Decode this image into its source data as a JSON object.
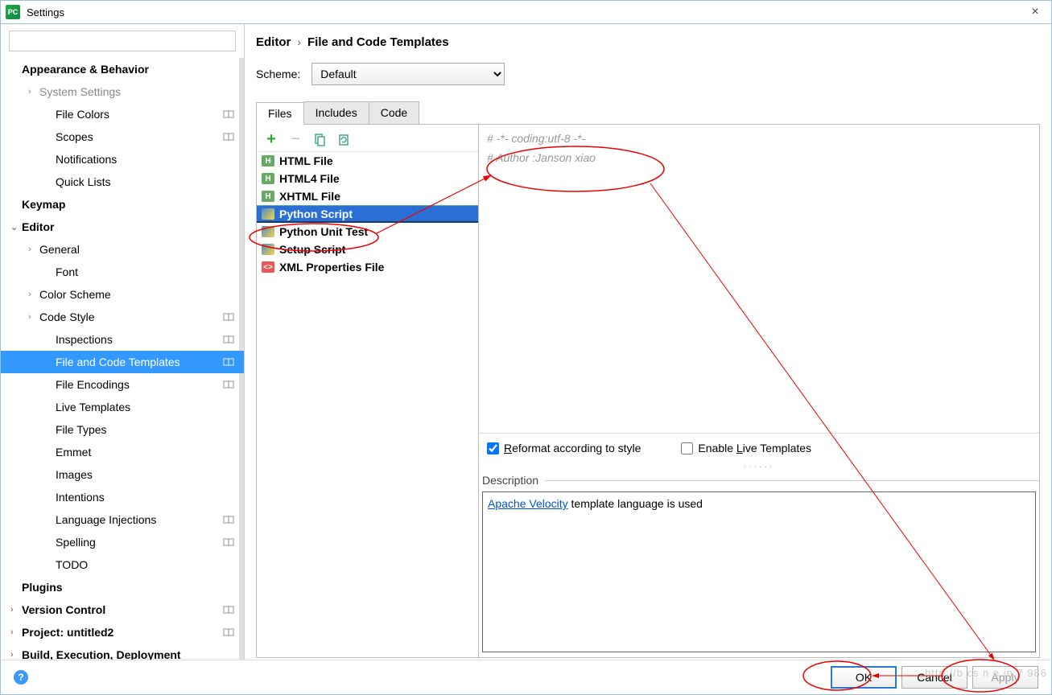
{
  "window": {
    "title": "Settings"
  },
  "search": {
    "placeholder": ""
  },
  "sidebar": {
    "items": [
      {
        "label": "Appearance & Behavior",
        "bold": true,
        "indent": 0,
        "chev": ""
      },
      {
        "label": "System Settings",
        "bold": false,
        "indent": 1,
        "dim": true,
        "chev": "›"
      },
      {
        "label": "File Colors",
        "indent": 2,
        "badge": true
      },
      {
        "label": "Scopes",
        "indent": 2,
        "badge": true
      },
      {
        "label": "Notifications",
        "indent": 2
      },
      {
        "label": "Quick Lists",
        "indent": 2
      },
      {
        "label": "Keymap",
        "bold": true,
        "indent": 0
      },
      {
        "label": "Editor",
        "bold": true,
        "indent": 0,
        "chev": "⌄",
        "expanded": true
      },
      {
        "label": "General",
        "indent": 1,
        "chev": "›"
      },
      {
        "label": "Font",
        "indent": 2
      },
      {
        "label": "Color Scheme",
        "indent": 1,
        "chev": "›"
      },
      {
        "label": "Code Style",
        "indent": 1,
        "chev": "›",
        "badge": true
      },
      {
        "label": "Inspections",
        "indent": 2,
        "badge": true
      },
      {
        "label": "File and Code Templates",
        "indent": 2,
        "badge": true,
        "selected": true
      },
      {
        "label": "File Encodings",
        "indent": 2,
        "badge": true
      },
      {
        "label": "Live Templates",
        "indent": 2
      },
      {
        "label": "File Types",
        "indent": 2
      },
      {
        "label": "Emmet",
        "indent": 2
      },
      {
        "label": "Images",
        "indent": 2
      },
      {
        "label": "Intentions",
        "indent": 2
      },
      {
        "label": "Language Injections",
        "indent": 2,
        "badge": true
      },
      {
        "label": "Spelling",
        "indent": 2,
        "badge": true
      },
      {
        "label": "TODO",
        "indent": 2
      },
      {
        "label": "Plugins",
        "bold": true,
        "indent": 0
      },
      {
        "label": "Version Control",
        "bold": true,
        "indent": 0,
        "chev": "›",
        "badge": true
      },
      {
        "label": "Project: untitled2",
        "bold": true,
        "indent": 0,
        "chev": "›",
        "badge": true
      },
      {
        "label": "Build, Execution, Deployment",
        "bold": true,
        "indent": 0,
        "chev": "›"
      }
    ]
  },
  "breadcrumb": {
    "parent": "Editor",
    "current": "File and Code Templates"
  },
  "scheme": {
    "label": "Scheme:",
    "value": "Default"
  },
  "tabs": [
    {
      "label": "Files",
      "active": true
    },
    {
      "label": "Includes"
    },
    {
      "label": "Code"
    }
  ],
  "templates": [
    {
      "label": "HTML File",
      "icon": "html"
    },
    {
      "label": "HTML4 File",
      "icon": "html"
    },
    {
      "label": "XHTML File",
      "icon": "html"
    },
    {
      "label": "Python Script",
      "icon": "py",
      "selected": true
    },
    {
      "label": "Python Unit Test",
      "icon": "py"
    },
    {
      "label": "Setup Script",
      "icon": "py"
    },
    {
      "label": "XML Properties File",
      "icon": "xml"
    }
  ],
  "editor": {
    "line1": "# -*- coding:utf-8 -*-",
    "line2": "# Author :Janson xiao"
  },
  "checks": {
    "reformat_pre": "R",
    "reformat_post": "eformat according to style",
    "enable_pre": "Enable ",
    "enable_mn": "L",
    "enable_post": "ive Templates",
    "reformat_checked": true,
    "enable_checked": false
  },
  "description": {
    "label": "Description",
    "link": "Apache Velocity",
    "rest": " template language is used"
  },
  "buttons": {
    "ok": "OK",
    "cancel": "Cancel",
    "apply": "Apply"
  },
  "watermark": "http://b  cs n    e  in  7 986"
}
